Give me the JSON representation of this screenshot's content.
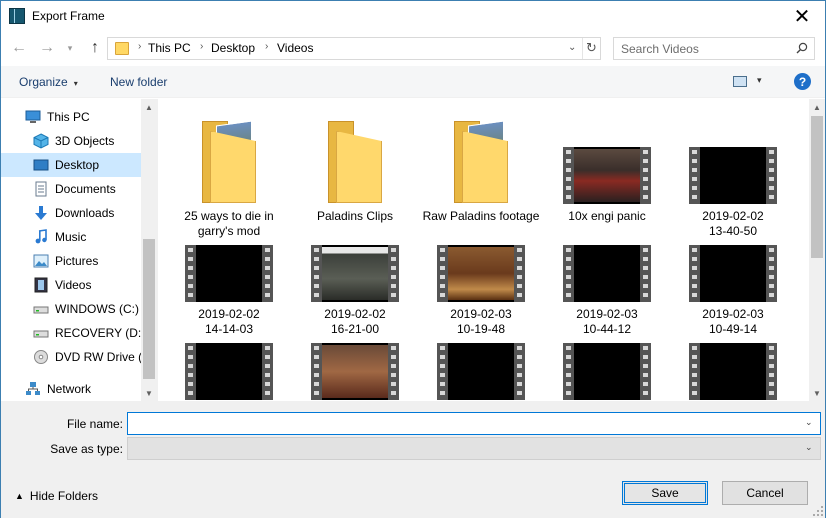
{
  "window": {
    "title": "Export Frame",
    "close_glyph": "✕"
  },
  "nav": {
    "back_glyph": "←",
    "forward_glyph": "→",
    "recent_glyph": "▾",
    "up_glyph": "↑",
    "breadcrumbs": [
      "This PC",
      "Desktop",
      "Videos"
    ],
    "separator": "›",
    "dropdown_glyph": "⌄",
    "refresh_glyph": "↻",
    "search_placeholder": "Search Videos"
  },
  "toolbar": {
    "organize_label": "Organize",
    "organize_caret": "▾",
    "new_folder_label": "New folder",
    "view_caret": "▾",
    "help_label": "?"
  },
  "sidebar": {
    "items": [
      {
        "label": "This PC",
        "icon": "computer-icon",
        "indent": 1
      },
      {
        "label": "3D Objects",
        "icon": "cube-icon",
        "indent": 2
      },
      {
        "label": "Desktop",
        "icon": "desktop-icon",
        "indent": 2,
        "selected": true
      },
      {
        "label": "Documents",
        "icon": "document-icon",
        "indent": 2
      },
      {
        "label": "Downloads",
        "icon": "download-icon",
        "indent": 2
      },
      {
        "label": "Music",
        "icon": "music-icon",
        "indent": 2
      },
      {
        "label": "Pictures",
        "icon": "picture-icon",
        "indent": 2
      },
      {
        "label": "Videos",
        "icon": "video-icon",
        "indent": 2
      },
      {
        "label": "WINDOWS (C:)",
        "icon": "drive-icon",
        "indent": 2
      },
      {
        "label": "RECOVERY (D:)",
        "icon": "drive-icon",
        "indent": 2
      },
      {
        "label": "DVD RW Drive (E",
        "icon": "dvd-icon",
        "indent": 2
      },
      {
        "label": "Network",
        "icon": "network-icon",
        "indent": 1
      }
    ]
  },
  "files": [
    {
      "name": "25 ways to die in garry's mod",
      "type": "folder",
      "art": "folder-with-images"
    },
    {
      "name": "Paladins Clips",
      "type": "folder",
      "art": "folder"
    },
    {
      "name": "Raw Paladins footage",
      "type": "folder",
      "art": "folder-with-images"
    },
    {
      "name": "10x engi panic",
      "type": "video",
      "art": "game-red"
    },
    {
      "name": "2019-02-02 13-40-50",
      "type": "video",
      "art": "black"
    },
    {
      "name": "2019-02-02 14-14-03",
      "type": "video",
      "art": "black"
    },
    {
      "name": "2019-02-02 16-21-00",
      "type": "video",
      "art": "game-gray"
    },
    {
      "name": "2019-02-03 10-19-48",
      "type": "video",
      "art": "game-orange"
    },
    {
      "name": "2019-02-03 10-44-12",
      "type": "video",
      "art": "black"
    },
    {
      "name": "2019-02-03 10-49-14",
      "type": "video",
      "art": "black"
    },
    {
      "name": "",
      "type": "video",
      "art": "black"
    },
    {
      "name": "",
      "type": "video",
      "art": "game-orange2"
    },
    {
      "name": "",
      "type": "video",
      "art": "black"
    },
    {
      "name": "",
      "type": "video",
      "art": "black"
    },
    {
      "name": "",
      "type": "video",
      "art": "black"
    }
  ],
  "form": {
    "file_name_label": "File name:",
    "file_name_value": "",
    "save_type_label": "Save as type:",
    "save_type_value": "",
    "dropdown_glyph": "⌄"
  },
  "footer": {
    "hide_folders_label": "Hide Folders",
    "hide_caret": "▲",
    "save_label": "Save",
    "cancel_label": "Cancel"
  },
  "colors": {
    "accent": "#0078d7",
    "selection": "#cce8ff",
    "folder": "#ffd86c"
  }
}
